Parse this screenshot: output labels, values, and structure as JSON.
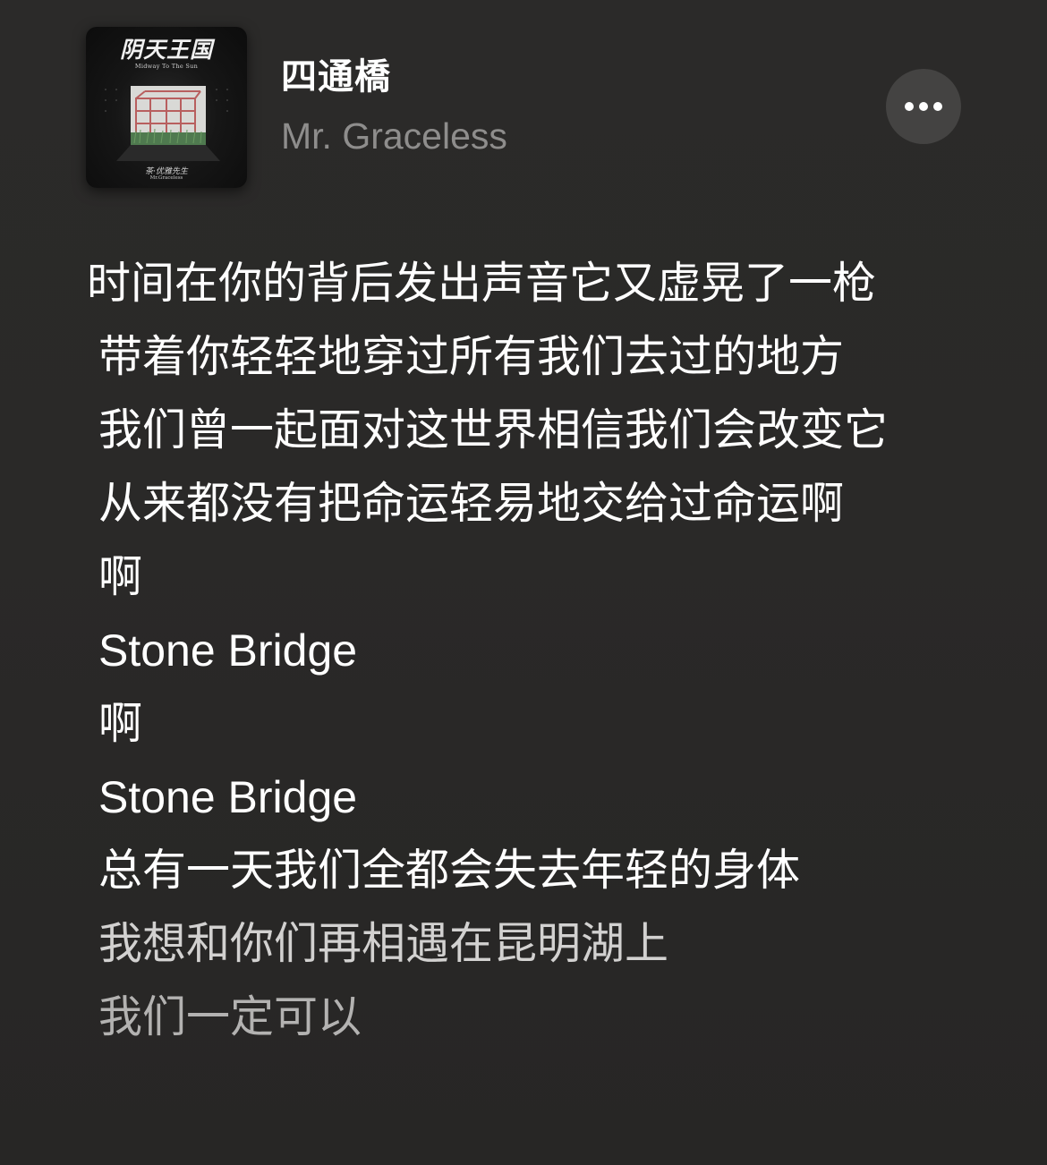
{
  "album": {
    "art_title": "阴天王国",
    "art_subtitle": "Midway To The Sun",
    "art_artist_cn": "茶·优雅先生",
    "art_artist_en": "Mr.Graceless",
    "icon": "album-cover-image"
  },
  "song": {
    "title": "四通橋",
    "artist": "Mr. Graceless"
  },
  "more_button": {
    "icon": "ellipsis-icon"
  },
  "lyrics": [
    "时间在你的背后发出声音它又虚晃了一枪",
    "带着你轻轻地穿过所有我们去过的地方",
    "我们曾一起面对这世界相信我们会改变它",
    "从来都没有把命运轻易地交给过命运啊",
    "啊",
    "Stone Bridge",
    "啊",
    "Stone Bridge",
    "总有一天我们全都会失去年轻的身体",
    "我想和你们再相遇在昆明湖上",
    "我们一定可以"
  ],
  "colors": {
    "background": "#2a2928",
    "lyric_active": "#ffffff",
    "artist_text": "#8e8d8c",
    "more_button_bg": "#444342"
  }
}
